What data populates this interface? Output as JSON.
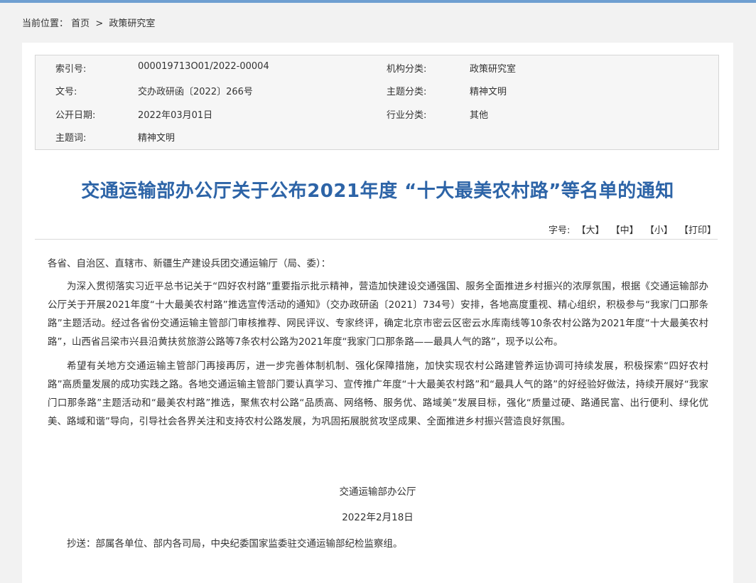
{
  "breadcrumb": {
    "prefix": "当前位置：",
    "home": "首页",
    "separator": ">",
    "current": "政策研究室"
  },
  "meta": {
    "index_label": "索引号:",
    "index_value": "000019713O01/2022-00004",
    "org_label": "机构分类:",
    "org_value": "政策研究室",
    "docno_label": "文号:",
    "docno_value": "交办政研函〔2022〕266号",
    "topic_label": "主题分类:",
    "topic_value": "精神文明",
    "date_label": "公开日期:",
    "date_value": "2022年03月01日",
    "industry_label": "行业分类:",
    "industry_value": "其他",
    "keyword_label": "主题词:",
    "keyword_value": "精神文明"
  },
  "article": {
    "title": "交通运输部办公厅关于公布2021年度 “十大最美农村路”等名单的通知",
    "fontsize": {
      "label": "字号:",
      "large": "【大】",
      "medium": "【中】",
      "small": "【小】",
      "print": "【打印】"
    },
    "salutation": "各省、自治区、直辖市、新疆生产建设兵团交通运输厅（局、委）：",
    "para1": "为深入贯彻落实习近平总书记关于“四好农村路”重要指示批示精神，营造加快建设交通强国、服务全面推进乡村振兴的浓厚氛围，根据《交通运输部办公厅关于开展2021年度“十大最美农村路”推选宣传活动的通知》（交办政研函〔2021〕734号）安排，各地高度重视、精心组织，积极参与“我家门口那条路”主题活动。经过各省份交通运输主管部门审核推荐、网民评议、专家终评，确定北京市密云区密云水库南线等10条农村公路为2021年度“十大最美农村路”，山西省吕梁市兴县沿黄扶贫旅游公路等7条农村公路为2021年度“我家门口那条路——最具人气的路”，现予以公布。",
    "para2": "希望有关地方交通运输主管部门再接再厉，进一步完善体制机制、强化保障措施，加快实现农村公路建管养运协调可持续发展，积极探索“四好农村路”高质量发展的成功实践之路。各地交通运输主管部门要认真学习、宣传推广年度“十大最美农村路”和“最具人气的路”的好经验好做法，持续开展好“我家门口那条路”主题活动和“最美农村路”推选，聚焦农村公路“品质高、网络畅、服务优、路域美”发展目标，强化“质量过硬、路通民富、出行便利、绿化优美、路域和谐”导向，引导社会各界关注和支持农村公路发展，为巩固拓展脱贫攻坚成果、全面推进乡村振兴营造良好氛围。",
    "signature": "交通运输部办公厅",
    "date": "2022年2月18日",
    "cc": "抄送：部属各单位、部内各司局，中央纪委国家监委驻交通运输部纪检监察组。"
  }
}
